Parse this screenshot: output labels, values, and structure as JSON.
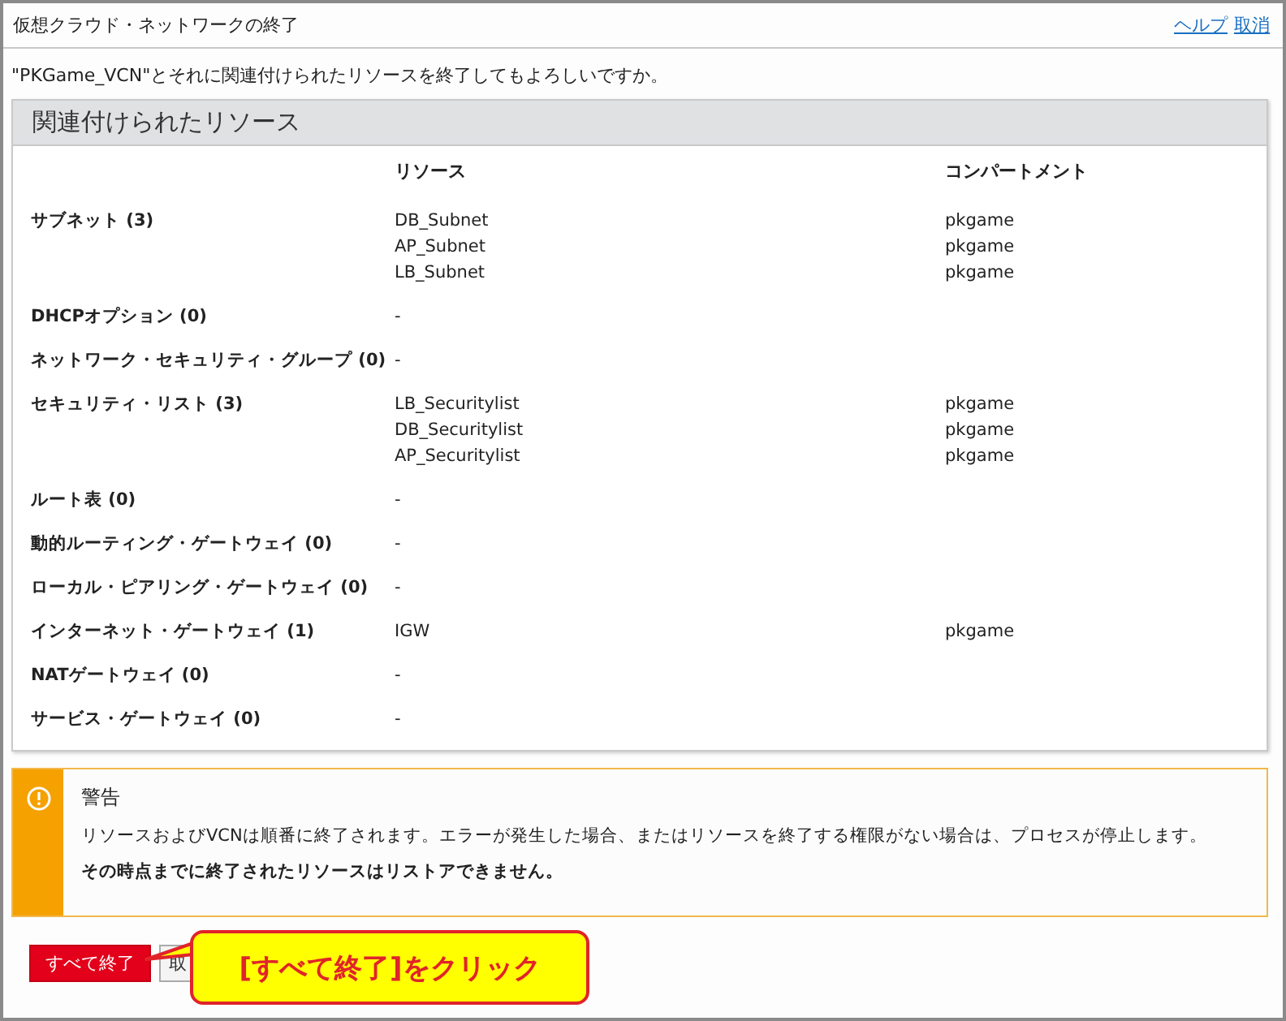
{
  "dialog": {
    "title": "仮想クラウド・ネットワークの終了",
    "links": [
      "ヘルプ",
      "取消"
    ]
  },
  "message": "\"PKGame_VCN\"とそれに関連付けられたリソースを終了してもよろしいですか。",
  "section": {
    "title": "関連付けられたリソース",
    "columns": [
      "リソース",
      "コンパートメント"
    ],
    "rows": [
      {
        "label": "サブネット (3)",
        "resources": [
          {
            "name": "DB_Subnet",
            "compartment": "pkgame"
          },
          {
            "name": "AP_Subnet",
            "compartment": "pkgame"
          },
          {
            "name": "LB_Subnet",
            "compartment": "pkgame"
          }
        ]
      },
      {
        "label": "DHCPオプション (0)",
        "resources": [
          {
            "name": "-"
          }
        ]
      },
      {
        "label": "ネットワーク・セキュリティ・グループ (0)",
        "resources": [
          {
            "name": "-"
          }
        ]
      },
      {
        "label": "セキュリティ・リスト (3)",
        "resources": [
          {
            "name": "LB_Securitylist",
            "compartment": "pkgame"
          },
          {
            "name": "DB_Securitylist",
            "compartment": "pkgame"
          },
          {
            "name": "AP_Securitylist",
            "compartment": "pkgame"
          }
        ]
      },
      {
        "label": "ルート表 (0)",
        "resources": [
          {
            "name": "-"
          }
        ]
      },
      {
        "label": "動的ルーティング・ゲートウェイ (0)",
        "resources": [
          {
            "name": "-"
          }
        ]
      },
      {
        "label": "ローカル・ピアリング・ゲートウェイ (0)",
        "resources": [
          {
            "name": "-"
          }
        ]
      },
      {
        "label": "インターネット・ゲートウェイ (1)",
        "resources": [
          {
            "name": "IGW",
            "compartment": "pkgame"
          }
        ]
      },
      {
        "label": "NATゲートウェイ (0)",
        "resources": [
          {
            "name": "-"
          }
        ]
      },
      {
        "label": "サービス・ゲートウェイ (0)",
        "resources": [
          {
            "name": "-"
          }
        ]
      }
    ]
  },
  "warning": {
    "title": "警告",
    "text": "リソースおよびVCNは順番に終了されます。エラーが発生した場合、またはリソースを終了する権限がない場合は、プロセスが停止します。",
    "note": "その時点までに終了されたリソースはリストアできません。"
  },
  "buttons": [
    {
      "label": "すべて終了",
      "kind": "primary"
    },
    {
      "label": "取",
      "kind": "secondary"
    }
  ],
  "callout": {
    "text": "[すべて終了]をクリック"
  }
}
